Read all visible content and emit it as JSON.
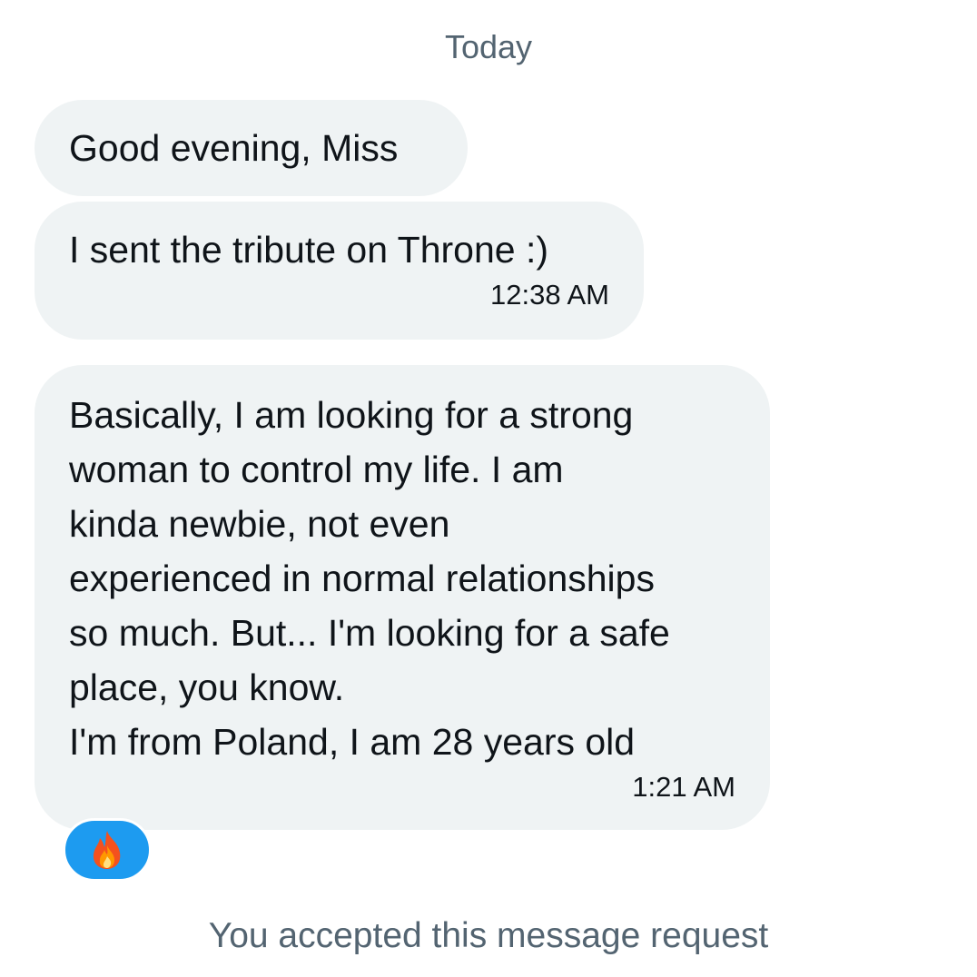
{
  "date_divider": "Today",
  "messages": [
    {
      "text": "Good evening, Miss",
      "time": ""
    },
    {
      "text": "I sent the tribute on Throne :)",
      "time": "12:38 AM"
    },
    {
      "text": "Basically, I am looking for a strong\nwoman to control my life. I am\nkinda newbie, not even\nexperienced in normal relationships\nso much. But... I'm looking for a safe\nplace, you know.\nI'm from Poland, I am 28 years old",
      "time": "1:21 AM"
    }
  ],
  "reaction": {
    "icon": "fire-icon",
    "color": "#1d9bf0"
  },
  "footer_note": "You accepted this message request",
  "colors": {
    "bubble_bg": "#eff3f4",
    "muted_text": "#536471",
    "text": "#0f1419"
  }
}
